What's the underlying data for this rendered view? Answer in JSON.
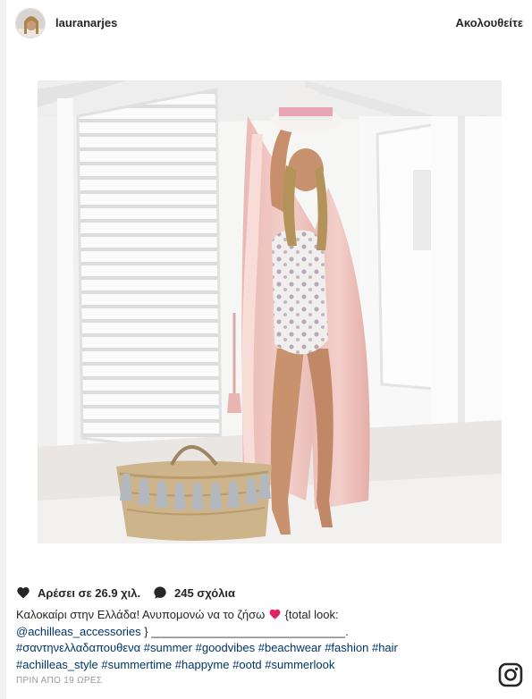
{
  "post": {
    "username": "lauranarjes",
    "follow_label": "Ακολουθείτε",
    "likes_label": "Αρέσει σε 26.9 χιλ.",
    "comments_label": "245 σχόλια",
    "caption": {
      "text_part1": "Καλοκαίρι στην Ελλάδα! Ανυπομονώ να το ζήσω",
      "text_part2": " {total look:",
      "mention": "@achilleas_accessories",
      "text_part3": " } ______________________________.",
      "hashtags_line1": [
        "#σαντηνελλαδαπουθενα",
        "#summer",
        "#goodvibes",
        "#beachwear",
        "#fashion",
        "#hair"
      ],
      "hashtags_line2": [
        "#achilleas_style",
        "#summertime",
        "#happyme",
        "#ootd",
        "#summerlook"
      ]
    },
    "timestamp": "ΠΡΙΝ ΑΠΟ 19 ΩΡΕΣ"
  },
  "icons": {
    "heart": "heart-icon",
    "comment": "comment-icon",
    "instagram": "instagram-icon",
    "emoji": "red-heart-emoji"
  },
  "colors": {
    "text": "#262626",
    "link": "#003569",
    "muted": "#999999",
    "emoji_heart": "#e0245e"
  }
}
